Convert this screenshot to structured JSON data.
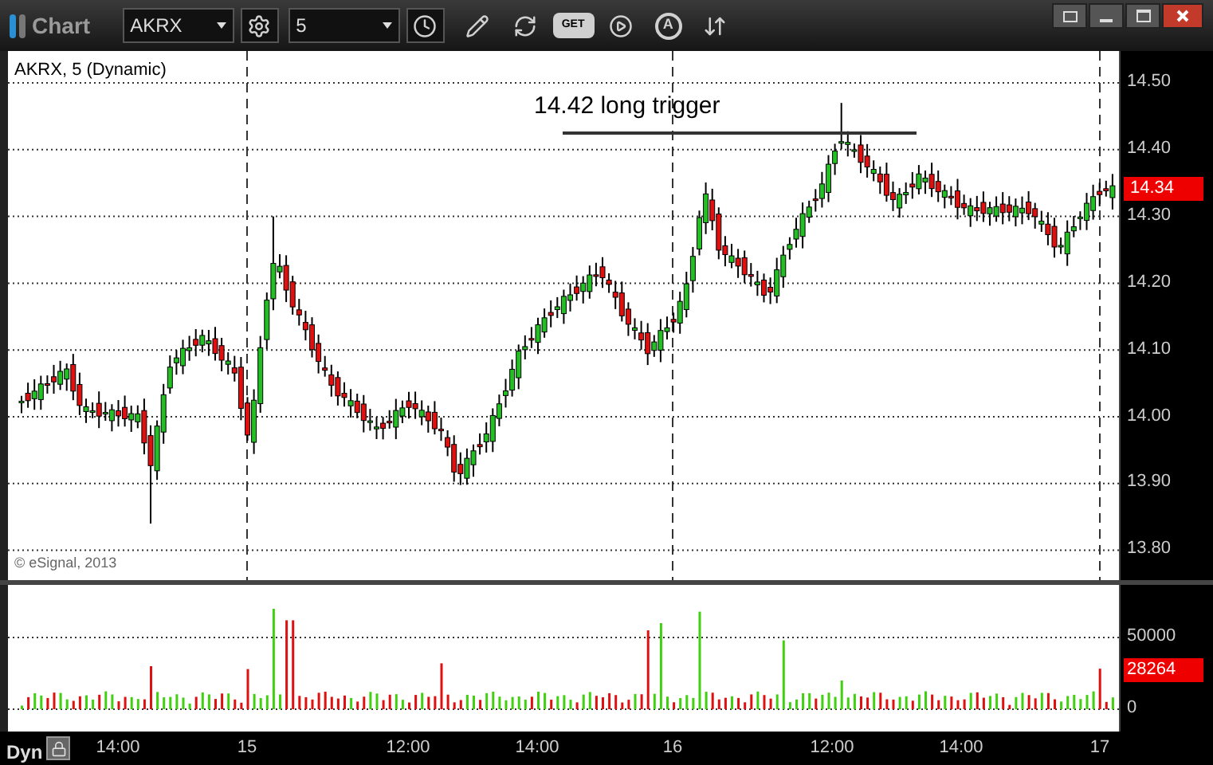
{
  "window": {
    "title": "Chart"
  },
  "toolbar": {
    "symbol": "AKRX",
    "interval": "5",
    "get_label": "GET",
    "auto_label": "A"
  },
  "chart": {
    "legend": "AKRX, 5 (Dynamic)",
    "annotation": "14.42 long trigger",
    "copyright": "© eSignal, 2013"
  },
  "price_axis": {
    "ticks": [
      "14.50",
      "14.40",
      "14.30",
      "14.20",
      "14.10",
      "14.00",
      "13.90",
      "13.80"
    ],
    "current": "14.34"
  },
  "volume_axis": {
    "ticks": [
      "50000",
      "0"
    ],
    "current": "28264"
  },
  "time_axis": {
    "mode": "Dyn",
    "labels": [
      "14:00",
      "15",
      "12:00",
      "14:00",
      "16",
      "12:00",
      "14:00",
      "17"
    ]
  }
}
